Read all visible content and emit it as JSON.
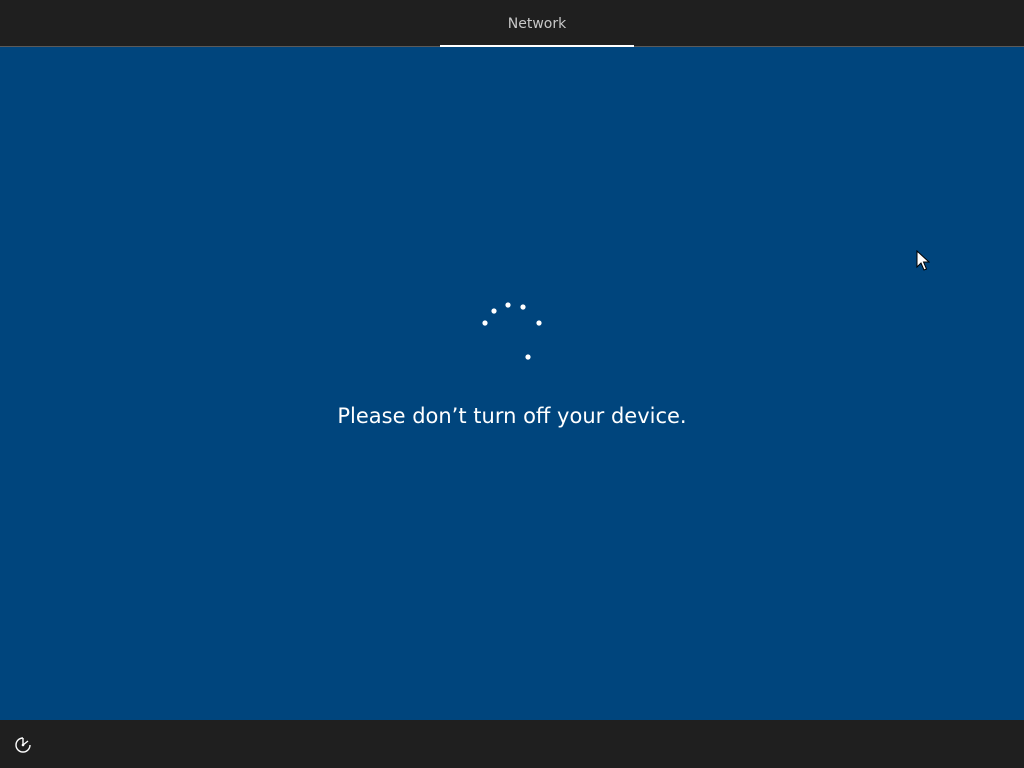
{
  "header": {
    "current_step": "Network"
  },
  "main": {
    "message": "Please don’t turn off your device.",
    "spinner_icon": "loading-spinner-icon"
  },
  "footer": {
    "accessibility_icon": "ease-of-access-icon"
  },
  "colors": {
    "background_blue": "#00457d",
    "bar_dark": "#1f1f1f",
    "text_white": "#ffffff",
    "tab_text": "#c8c8c8"
  }
}
